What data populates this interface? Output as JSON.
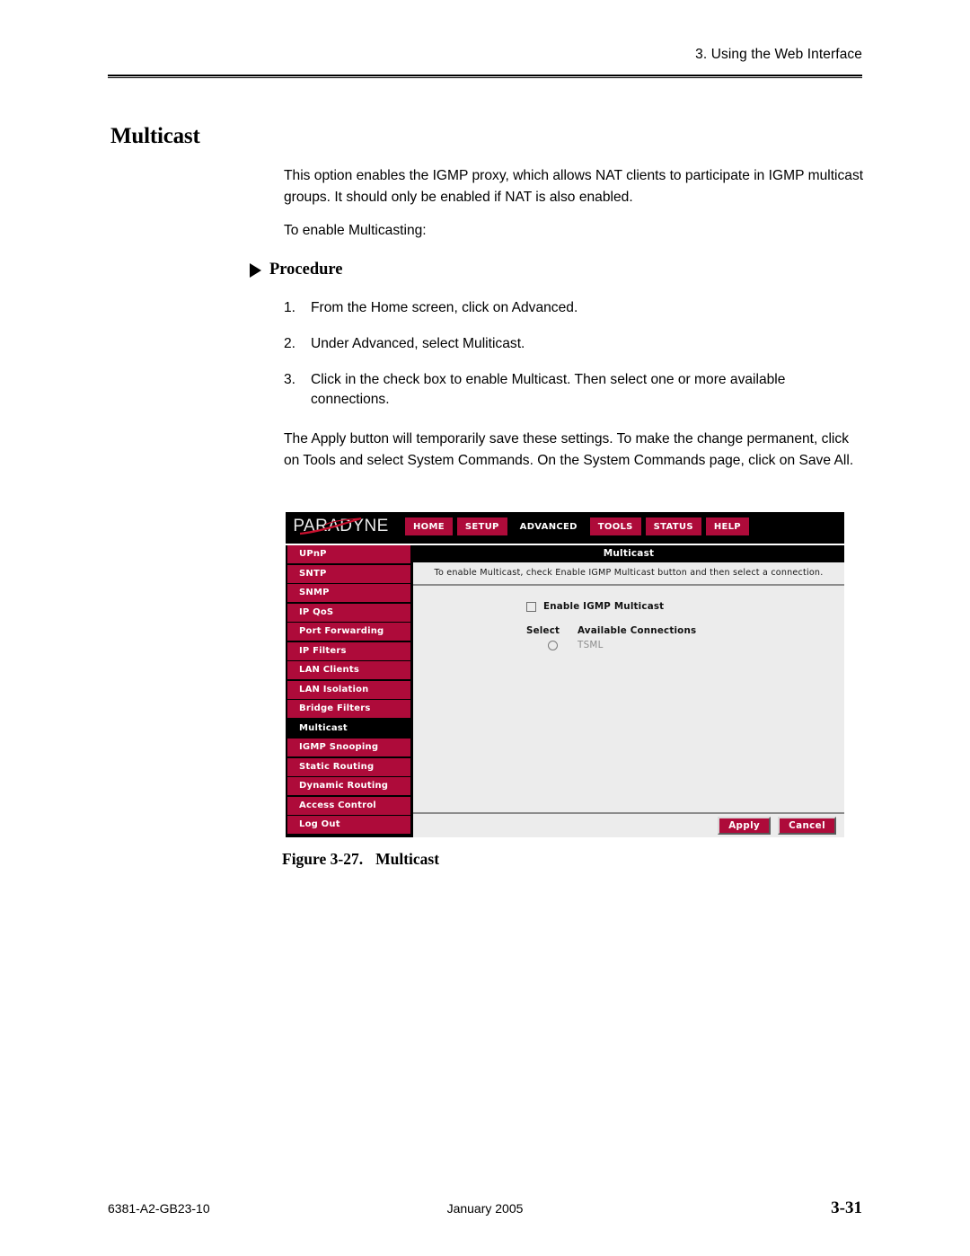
{
  "page": {
    "running_head": "3. Using the Web Interface",
    "section_title": "Multicast",
    "intro_paragraph": "This option enables the IGMP proxy, which allows NAT clients to participate in IGMP multicast groups. It should only be enabled if NAT is also enabled.",
    "lead_in": "To enable Multicasting:",
    "procedure_label": "Procedure",
    "steps": [
      {
        "num": "1.",
        "text": "From the Home screen, click on Advanced."
      },
      {
        "num": "2.",
        "text": "Under Advanced, select Muliticast."
      },
      {
        "num": "3.",
        "text": "Click in the check box to enable Multicast. Then select one or more available connections."
      }
    ],
    "closing_paragraph": "The Apply button will temporarily save these settings. To make the change permanent, click on Tools and select System Commands. On the System Commands page, click on Save All.",
    "figure_caption_label": "Figure 3-27.",
    "figure_caption_title": "Multicast"
  },
  "footer": {
    "document_number": "6381-A2-GB23-10",
    "date": "January 2005",
    "page_number": "3-31"
  },
  "screenshot": {
    "brand": "PARADYNE",
    "nav_tabs": [
      {
        "label": "HOME",
        "active": false
      },
      {
        "label": "SETUP",
        "active": false
      },
      {
        "label": "ADVANCED",
        "active": true
      },
      {
        "label": "TOOLS",
        "active": false
      },
      {
        "label": "STATUS",
        "active": false
      },
      {
        "label": "HELP",
        "active": false
      }
    ],
    "sidebar": [
      {
        "label": "UPnP",
        "active": false
      },
      {
        "label": "SNTP",
        "active": false
      },
      {
        "label": "SNMP",
        "active": false
      },
      {
        "label": "IP QoS",
        "active": false
      },
      {
        "label": "Port Forwarding",
        "active": false
      },
      {
        "label": "IP Filters",
        "active": false
      },
      {
        "label": "LAN Clients",
        "active": false
      },
      {
        "label": "LAN Isolation",
        "active": false
      },
      {
        "label": "Bridge Filters",
        "active": false
      },
      {
        "label": "Multicast",
        "active": true
      },
      {
        "label": "IGMP Snooping",
        "active": false
      },
      {
        "label": "Static Routing",
        "active": false
      },
      {
        "label": "Dynamic Routing",
        "active": false
      },
      {
        "label": "Access Control",
        "active": false
      },
      {
        "label": "Log Out",
        "active": false
      }
    ],
    "panel": {
      "title": "Multicast",
      "instructions": "To enable Multicast, check Enable IGMP Multicast button and then select a connection.",
      "enable_checkbox_label": "Enable IGMP Multicast",
      "enable_checkbox_checked": false,
      "column_headers": {
        "select": "Select",
        "available_connections": "Available Connections"
      },
      "connections": [
        {
          "name": "TSML",
          "selected": false
        }
      ],
      "apply_label": "Apply",
      "cancel_label": "Cancel"
    },
    "colors": {
      "crimson": "#ae0b3a",
      "panel_background": "#ececec",
      "header_background": "#000000"
    }
  }
}
